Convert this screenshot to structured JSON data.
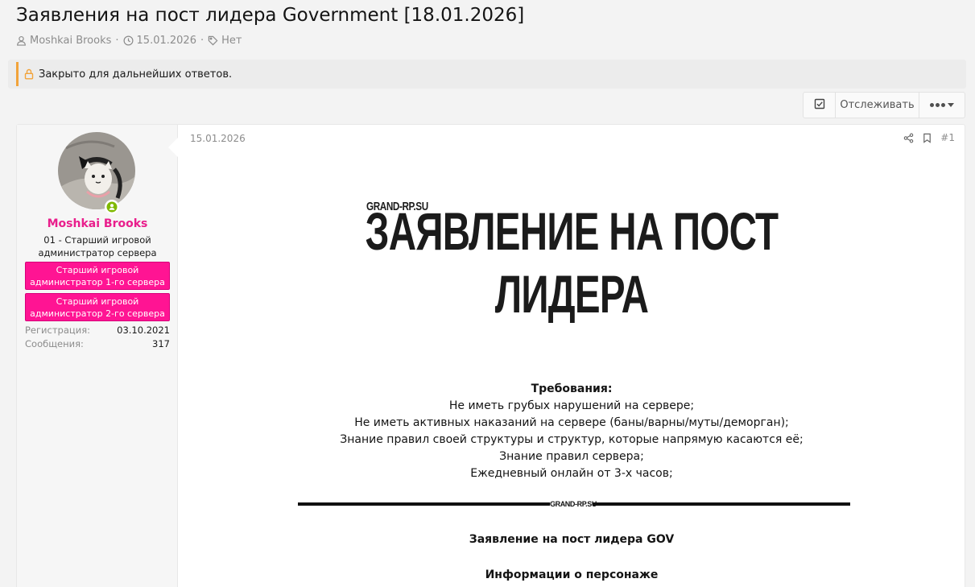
{
  "thread": {
    "title": "Заявления на пост лидера Government [18.01.2026]",
    "author": "Moshkai Brooks",
    "date": "15.01.2026",
    "tags": "Нет"
  },
  "closed_notice": "Закрыто для дальнейших ответов.",
  "actions": {
    "watch_label": "Отслеживать"
  },
  "post": {
    "date": "15.01.2026",
    "number": "#1",
    "user": {
      "name": "Moshkai Brooks",
      "title": "01 - Старший игровой администратор сервера",
      "banners": [
        "Старший игровой администратор 1-го сервера",
        "Старший игровой администратор 2-го сервера"
      ],
      "stats": [
        {
          "label": "Регистрация:",
          "value": "03.10.2021"
        },
        {
          "label": "Сообщения:",
          "value": "317"
        }
      ]
    },
    "hero": {
      "logo": "GRAND-RP.SU",
      "title_line1": "ЗАЯВЛЕНИЕ НА ПОСТ",
      "title_line2": "ЛИДЕРА"
    },
    "requirements": {
      "heading": "Требования:",
      "items": [
        "Не иметь грубых нарушений на сервере;",
        "Не иметь активных наказаний на сервере (баны/варны/муты/деморган);",
        "Знание правил своей структуры и структур, которые напрямую касаются её;",
        "Знание правил сервера;",
        "Ежедневный онлайн от 3-х часов;"
      ]
    },
    "divider_logo": "GRAND-RP.SU",
    "section_title": "Заявление на пост лидера GOV",
    "section_subtitle": "Информации о персонаже"
  },
  "colors": {
    "username": "#e91e8c",
    "banner": "#ff1493",
    "closed_accent": "#f2a33a",
    "online": "#7fb900"
  }
}
